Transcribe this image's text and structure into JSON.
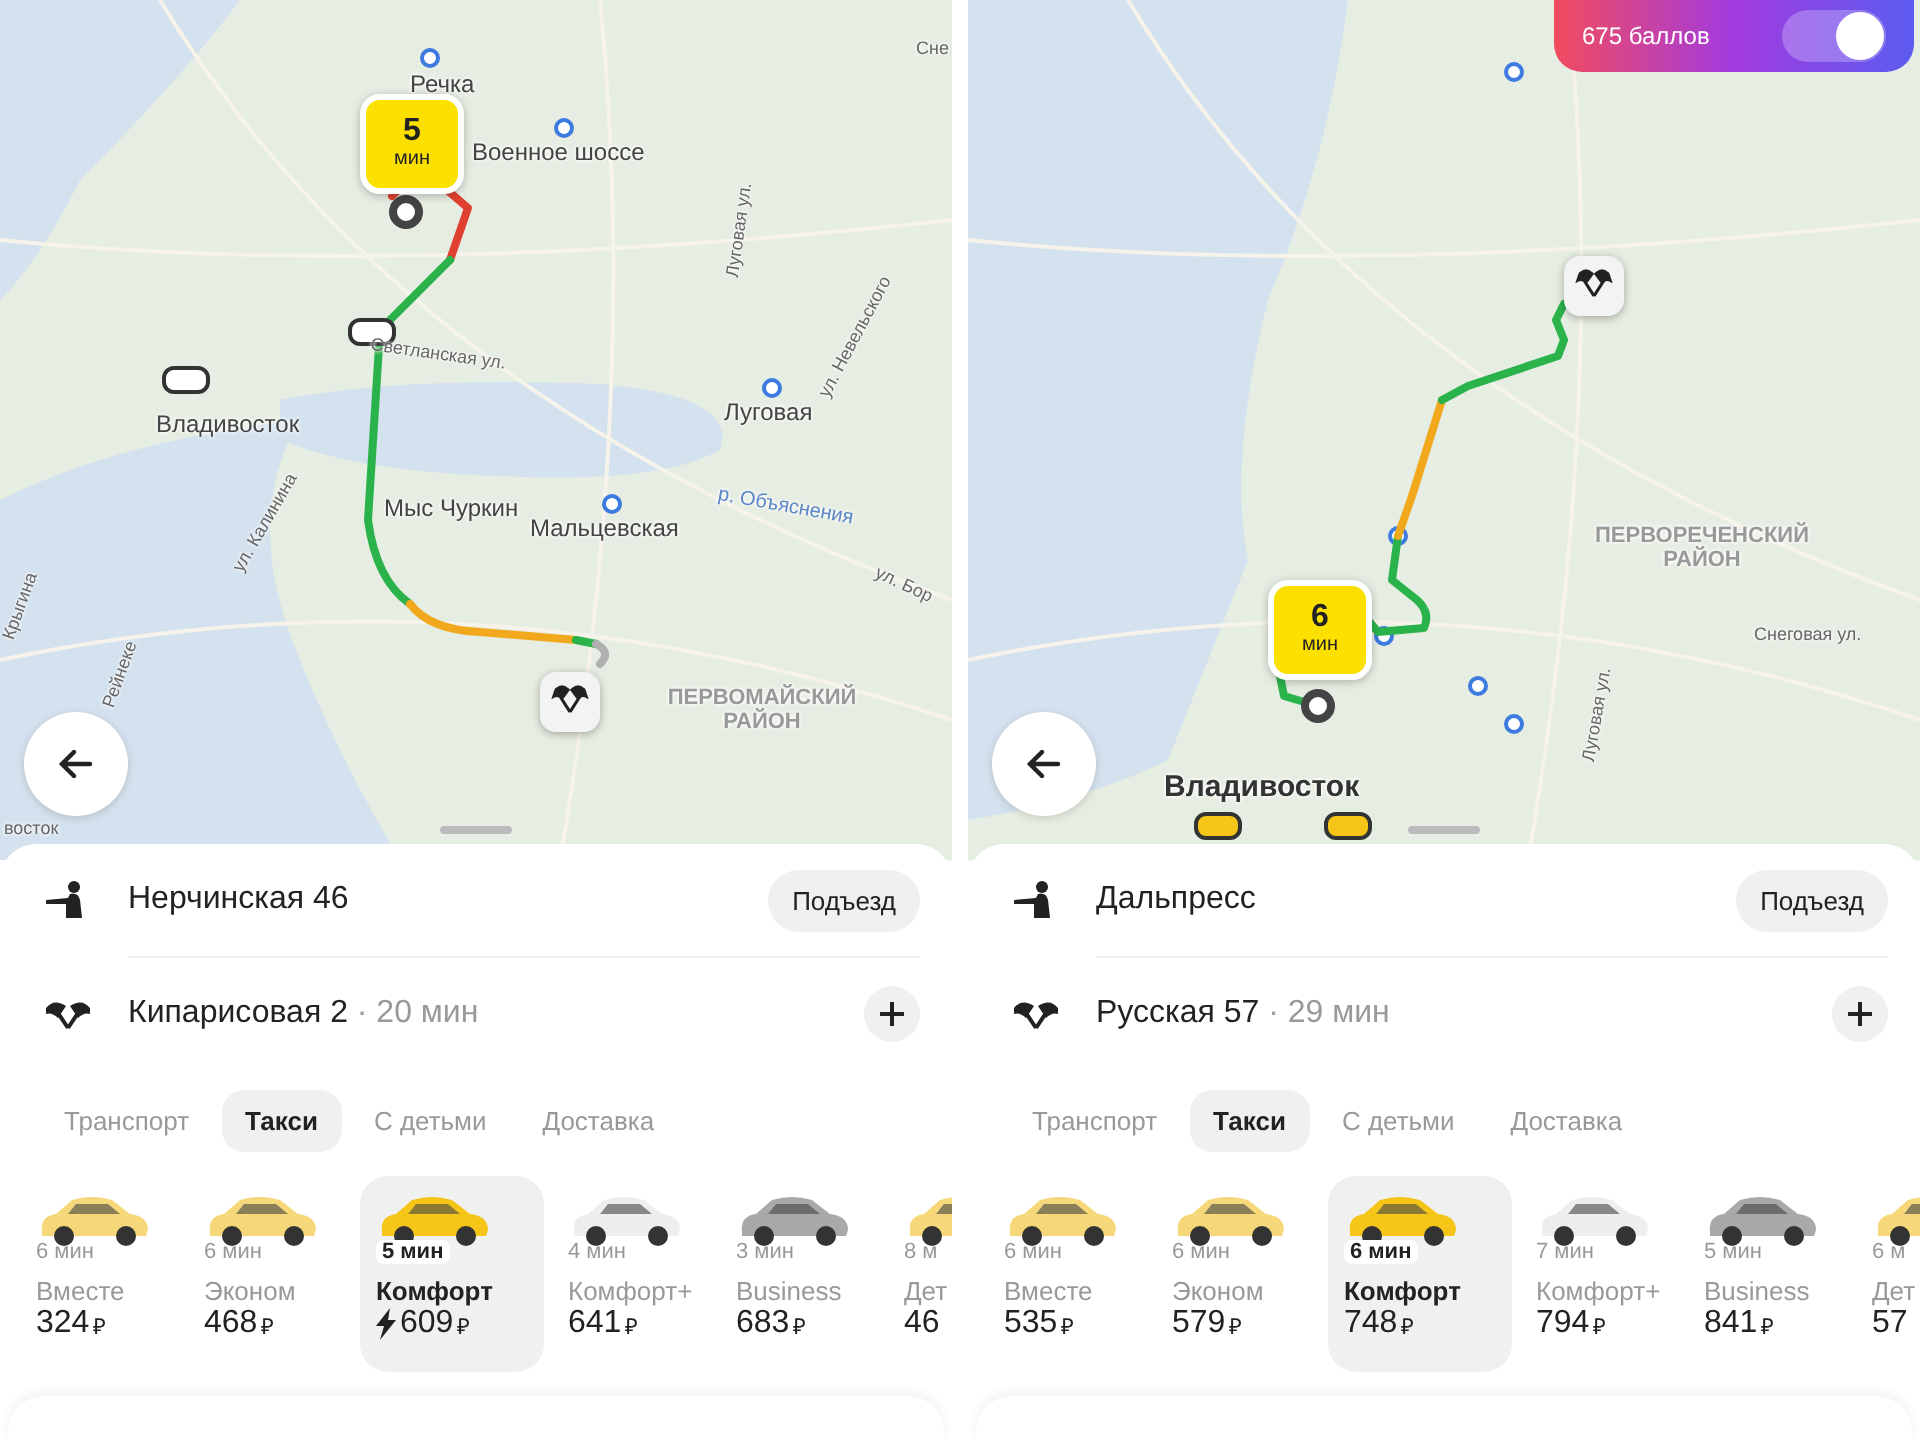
{
  "screens": [
    {
      "map": {
        "labels": [
          {
            "kind": "place",
            "text": "Речка"
          },
          {
            "kind": "place",
            "text": "Военное шоссе"
          },
          {
            "kind": "street",
            "text": "Светланская ул."
          },
          {
            "kind": "place",
            "text": "Владивосток"
          },
          {
            "kind": "place",
            "text": "Луговая"
          },
          {
            "kind": "street",
            "text": "ул. Невельского"
          },
          {
            "kind": "water",
            "text": "р. Объяснения"
          },
          {
            "kind": "place",
            "text": "Мыс Чуркин"
          },
          {
            "kind": "place",
            "text": "Мальцевская"
          },
          {
            "kind": "street",
            "text": "ул. Калинина"
          },
          {
            "kind": "district",
            "text": "ПЕРВОМАЙСКИЙ РАЙОН"
          },
          {
            "kind": "street",
            "text": "Луговая ул."
          },
          {
            "kind": "street",
            "text": "Сне"
          },
          {
            "kind": "street",
            "text": "ул. Бор"
          },
          {
            "kind": "street",
            "text": "Крыгина"
          },
          {
            "kind": "street",
            "text": "Рейнеке"
          },
          {
            "kind": "street",
            "text": "восток"
          }
        ],
        "eta": {
          "value": "5",
          "unit": "мин"
        }
      },
      "pickup": {
        "address": "Нерчинская 46",
        "button": "Подъезд"
      },
      "destination": {
        "address": "Кипарисовая 2",
        "separator": "·",
        "duration": "20 мин"
      },
      "tabs": [
        {
          "label": "Транспорт",
          "selected": false
        },
        {
          "label": "Такси",
          "selected": true
        },
        {
          "label": "С детьми",
          "selected": false
        },
        {
          "label": "Доставка",
          "selected": false
        }
      ],
      "tariffs": [
        {
          "eta": "6 мин",
          "name": "Вместе",
          "price": "324",
          "currency": "₽",
          "selected": false,
          "surge": false,
          "color": "#f6d77a"
        },
        {
          "eta": "6 мин",
          "name": "Эконом",
          "price": "468",
          "currency": "₽",
          "selected": false,
          "surge": false,
          "color": "#f6d77a"
        },
        {
          "eta": "5 мин",
          "name": "Комфорт",
          "price": "609",
          "currency": "₽",
          "selected": true,
          "surge": true,
          "color": "#f5c518"
        },
        {
          "eta": "4 мин",
          "name": "Комфорт+",
          "price": "641",
          "currency": "₽",
          "selected": false,
          "surge": false,
          "color": "#eeeeee"
        },
        {
          "eta": "3 мин",
          "name": "Business",
          "price": "683",
          "currency": "₽",
          "selected": false,
          "surge": false,
          "color": "#a9a9a9"
        },
        {
          "eta": "8 м",
          "name": "Дет",
          "price": "46",
          "selected": false,
          "surge": false,
          "color": "#f6d77a"
        }
      ]
    },
    {
      "bonus": {
        "text": "675 баллов",
        "on": true
      },
      "map": {
        "labels": [
          {
            "kind": "district",
            "text": "ПЕРВОРЕЧЕНСКИЙ РАЙОН"
          },
          {
            "kind": "street",
            "text": "Снеговая ул."
          },
          {
            "kind": "street",
            "text": "Луговая ул."
          },
          {
            "kind": "city",
            "text": "Владивосток"
          }
        ],
        "eta": {
          "value": "6",
          "unit": "мин"
        }
      },
      "pickup": {
        "address": "Дальпресс",
        "button": "Подъезд"
      },
      "destination": {
        "address": "Русская 57",
        "separator": "·",
        "duration": "29 мин"
      },
      "tabs": [
        {
          "label": "Транспорт",
          "selected": false
        },
        {
          "label": "Такси",
          "selected": true
        },
        {
          "label": "С детьми",
          "selected": false
        },
        {
          "label": "Доставка",
          "selected": false
        }
      ],
      "tariffs": [
        {
          "eta": "6 мин",
          "name": "Вместе",
          "price": "535",
          "currency": "₽",
          "selected": false,
          "surge": false,
          "color": "#f6d77a"
        },
        {
          "eta": "6 мин",
          "name": "Эконом",
          "price": "579",
          "currency": "₽",
          "selected": false,
          "surge": false,
          "color": "#f6d77a"
        },
        {
          "eta": "6 мин",
          "name": "Комфорт",
          "price": "748",
          "currency": "₽",
          "selected": true,
          "surge": false,
          "color": "#f5c518"
        },
        {
          "eta": "7 мин",
          "name": "Комфорт+",
          "price": "794",
          "currency": "₽",
          "selected": false,
          "surge": false,
          "color": "#eeeeee"
        },
        {
          "eta": "5 мин",
          "name": "Business",
          "price": "841",
          "currency": "₽",
          "selected": false,
          "surge": false,
          "color": "#a9a9a9"
        },
        {
          "eta": "6 м",
          "name": "Дет",
          "price": "57",
          "selected": false,
          "surge": false,
          "color": "#f6d77a"
        }
      ]
    }
  ]
}
